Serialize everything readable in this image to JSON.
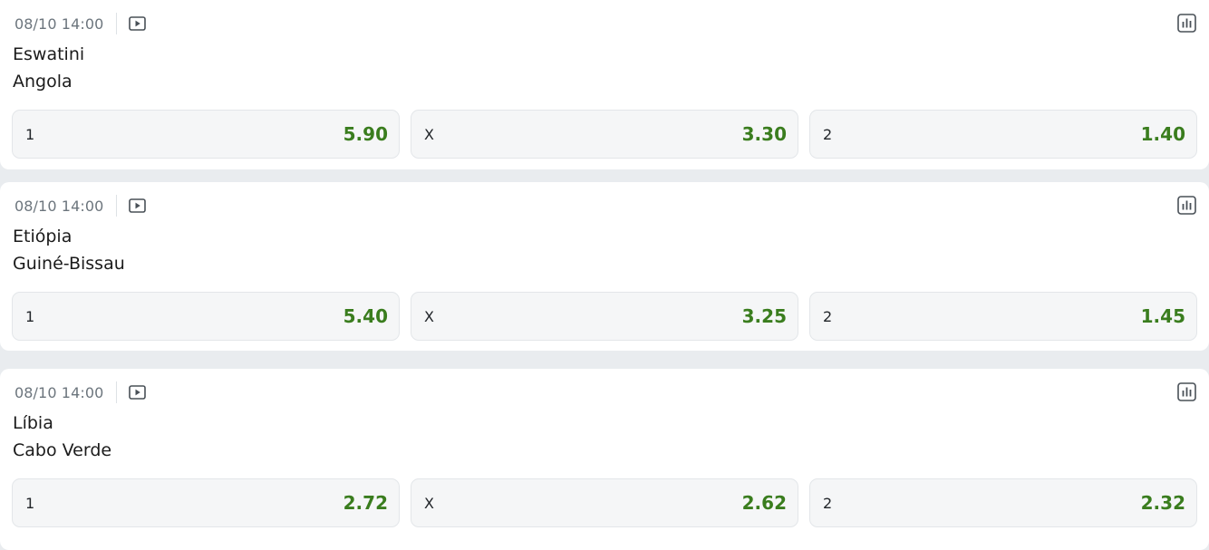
{
  "events": [
    {
      "datetime": "08/10 14:00",
      "home": "Eswatini",
      "away": "Angola",
      "odds": [
        {
          "label": "1",
          "value": "5.90"
        },
        {
          "label": "X",
          "value": "3.30"
        },
        {
          "label": "2",
          "value": "1.40"
        }
      ]
    },
    {
      "datetime": "08/10 14:00",
      "home": "Etiópia",
      "away": "Guiné-Bissau",
      "odds": [
        {
          "label": "1",
          "value": "5.40"
        },
        {
          "label": "X",
          "value": "3.25"
        },
        {
          "label": "2",
          "value": "1.45"
        }
      ]
    },
    {
      "datetime": "08/10 14:00",
      "home": "Líbia",
      "away": "Cabo Verde",
      "odds": [
        {
          "label": "1",
          "value": "2.72"
        },
        {
          "label": "X",
          "value": "2.62"
        },
        {
          "label": "2",
          "value": "2.32"
        }
      ]
    }
  ],
  "icons": {
    "play": "play-icon",
    "stats": "stats-icon"
  },
  "colors": {
    "odd_value": "#3a7d1e",
    "page_bg": "#e9ecef",
    "card_bg": "#ffffff",
    "odd_bg": "#f5f6f7"
  }
}
